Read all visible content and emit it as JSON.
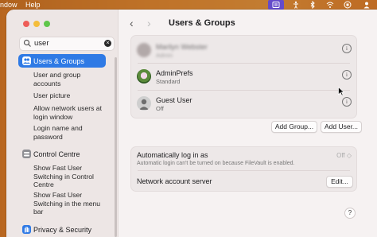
{
  "menubar": {
    "items": [
      "ndow",
      "Help"
    ],
    "icons": [
      "control-center-icon",
      "accessibility-icon",
      "bluetooth-icon",
      "wifi-icon",
      "record-icon",
      "user-icon"
    ]
  },
  "sidebar": {
    "search": {
      "value": "user",
      "clear": "×"
    },
    "items": [
      {
        "label": "Users & Groups",
        "icon": "users-icon",
        "color": "#2f7ae5",
        "selected": true
      },
      {
        "label": "Control Centre",
        "icon": "control-centre-icon",
        "color": "#8e8e93"
      },
      {
        "label": "Privacy & Security",
        "icon": "hand-icon",
        "color": "#2f7ae5"
      }
    ],
    "subs_users": [
      "User and group accounts",
      "User picture",
      "Allow network users at login window",
      "Login name and password"
    ],
    "subs_control": [
      "Show Fast User Switching in Control Centre",
      "Show Fast User Switching in the menu bar"
    ]
  },
  "content": {
    "back": "‹",
    "forward": "›",
    "title": "Users & Groups",
    "users": [
      {
        "name": "Marilyn Webster",
        "role": "Admin",
        "blurred": true
      },
      {
        "name": "AdminPrefs",
        "role": "Standard"
      },
      {
        "name": "Guest User",
        "role": "Off"
      }
    ],
    "info_glyph": "i",
    "add_group": "Add Group...",
    "add_user": "Add User...",
    "auto_login_label": "Automatically log in as",
    "auto_login_value": "Off ◇",
    "auto_login_note": "Automatic login can't be turned on because FileVault is enabled.",
    "network_label": "Network account server",
    "edit": "Edit...",
    "help": "?"
  },
  "colors": {
    "accent": "#2f7ae5",
    "window": "#f6f2f2",
    "sidebar": "#ede6e5"
  }
}
